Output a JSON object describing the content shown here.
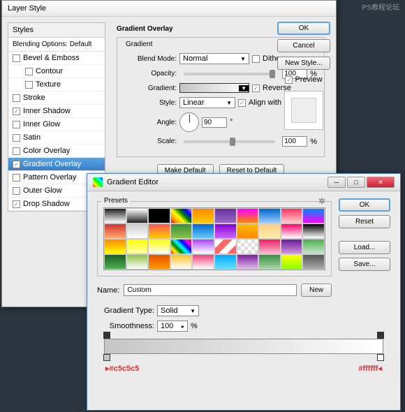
{
  "watermark": "PS教程论坛",
  "layerStyle": {
    "title": "Layer Style",
    "stylesHeader": "Styles",
    "blendingOptions": "Blending Options: Default",
    "items": [
      {
        "label": "Bevel & Emboss",
        "checked": false,
        "indent": false
      },
      {
        "label": "Contour",
        "checked": false,
        "indent": true
      },
      {
        "label": "Texture",
        "checked": false,
        "indent": true
      },
      {
        "label": "Stroke",
        "checked": false,
        "indent": false
      },
      {
        "label": "Inner Shadow",
        "checked": true,
        "indent": false
      },
      {
        "label": "Inner Glow",
        "checked": false,
        "indent": false
      },
      {
        "label": "Satin",
        "checked": false,
        "indent": false
      },
      {
        "label": "Color Overlay",
        "checked": false,
        "indent": false
      },
      {
        "label": "Gradient Overlay",
        "checked": true,
        "indent": false,
        "selected": true
      },
      {
        "label": "Pattern Overlay",
        "checked": false,
        "indent": false
      },
      {
        "label": "Outer Glow",
        "checked": false,
        "indent": false
      },
      {
        "label": "Drop Shadow",
        "checked": true,
        "indent": false
      }
    ],
    "section": "Gradient Overlay",
    "subsection": "Gradient",
    "labels": {
      "blendMode": "Blend Mode:",
      "opacity": "Opacity:",
      "gradient": "Gradient:",
      "style": "Style:",
      "angle": "Angle:",
      "scale": "Scale:",
      "dither": "Dither",
      "reverse": "Reverse",
      "alignWithLayer": "Align with Layer"
    },
    "values": {
      "blendMode": "Normal",
      "opacity": "100",
      "style": "Linear",
      "angle": "90",
      "scale": "100",
      "dither": false,
      "reverse": true,
      "alignWithLayer": true,
      "percent": "%",
      "degree": "°"
    },
    "buttons": {
      "makeDefault": "Make Default",
      "resetDefault": "Reset to Default",
      "ok": "OK",
      "cancel": "Cancel",
      "newStyle": "New Style...",
      "preview": "Preview"
    }
  },
  "gradientEditor": {
    "title": "Gradient Editor",
    "presets": "Presets",
    "name": "Name:",
    "nameValue": "Custom",
    "gradientType": "Gradient Type:",
    "gradientTypeValue": "Solid",
    "smoothness": "Smoothness:",
    "smoothnessValue": "100",
    "percent": "%",
    "buttons": {
      "ok": "OK",
      "reset": "Reset",
      "load": "Load...",
      "save": "Save...",
      "new": "New"
    },
    "hexLeft": "#c5c5c5",
    "hexRight": "#ffffff",
    "swatches": [
      "linear-gradient(#222,#fff)",
      "linear-gradient(#fff,#222)",
      "linear-gradient(#000,#000)",
      "linear-gradient(45deg,red,orange,yellow,green,blue,violet)",
      "linear-gradient(#f80,#fc0)",
      "linear-gradient(#639,#96c)",
      "linear-gradient(#f0f,#f80)",
      "linear-gradient(#06c,#9cf)",
      "linear-gradient(#f36,#fcc)",
      "linear-gradient(#08f,#f0f)",
      "linear-gradient(#c33,#fa6)",
      "linear-gradient(#ccc,#fff)",
      "linear-gradient(#f55,#fc0)",
      "linear-gradient(#388e3c,#8bc34a)",
      "linear-gradient(#06c,#6cf)",
      "linear-gradient(#80c,#c6f)",
      "linear-gradient(#fb0,#f80)",
      "linear-gradient(#fc8,#fea)",
      "linear-gradient(#f06,#fff)",
      "linear-gradient(#000,#fff)",
      "linear-gradient(#f80,#ff0)",
      "linear-gradient(#ff0,#ffa)",
      "linear-gradient(#ff0,#fff)",
      "linear-gradient(45deg,red,yellow,green,cyan,blue,magenta,red)",
      "linear-gradient(#a4f,#fff)",
      "linear-gradient(135deg,#fff 25%,#f66 25%,#f66 50%,#fff 50%,#fff 75%,#f66 75%)",
      "repeating-conic-gradient(#ddd 0 25%,#fff 0 50%) 0/10px 10px",
      "linear-gradient(#e91e63,#f8bbd0)",
      "linear-gradient(#6a1b9a,#ce93d8)",
      "linear-gradient(#4caf50,#c8e6c9)",
      "linear-gradient(#1b5e20,#4caf50)",
      "linear-gradient(#8bc34a,#fff)",
      "linear-gradient(#e65100,#ff9800)",
      "linear-gradient(#fbc02d,#fff)",
      "linear-gradient(#ec407a,#fff)",
      "linear-gradient(#0af,#6df)",
      "linear-gradient(#7b1fa2,#e1bee7)",
      "linear-gradient(#388e3c,#a5d6a7)",
      "linear-gradient(#ff0,#8f0)",
      "linear-gradient(#555,#aaa)"
    ]
  }
}
